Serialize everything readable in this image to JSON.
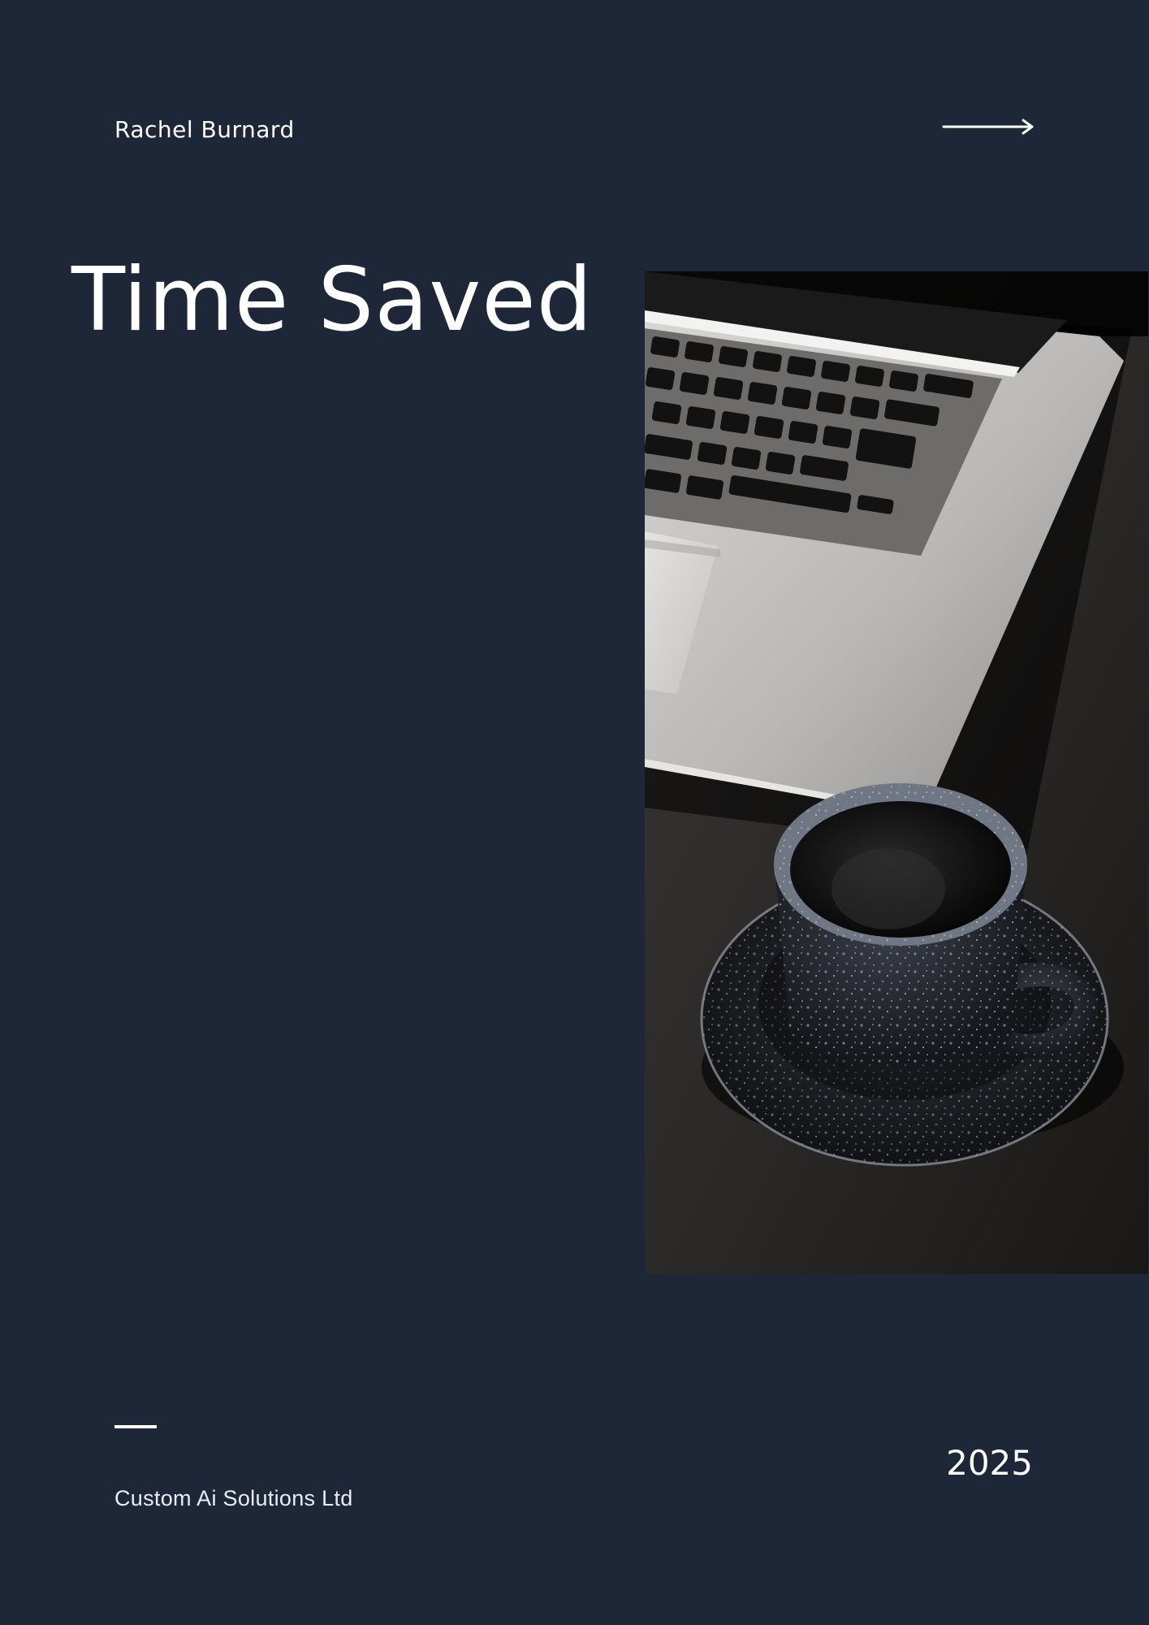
{
  "cover": {
    "author": "Rachel Burnard",
    "title": "Time Saved",
    "company": "Custom Ai Solutions Ltd",
    "year": "2025"
  },
  "icons": {
    "next": "arrow-right-icon",
    "separator": "dash-line"
  },
  "photo": {
    "subject": "laptop-and-coffee-cup-photo"
  },
  "colors": {
    "background": "#1e2738",
    "text": "#ffffff"
  }
}
